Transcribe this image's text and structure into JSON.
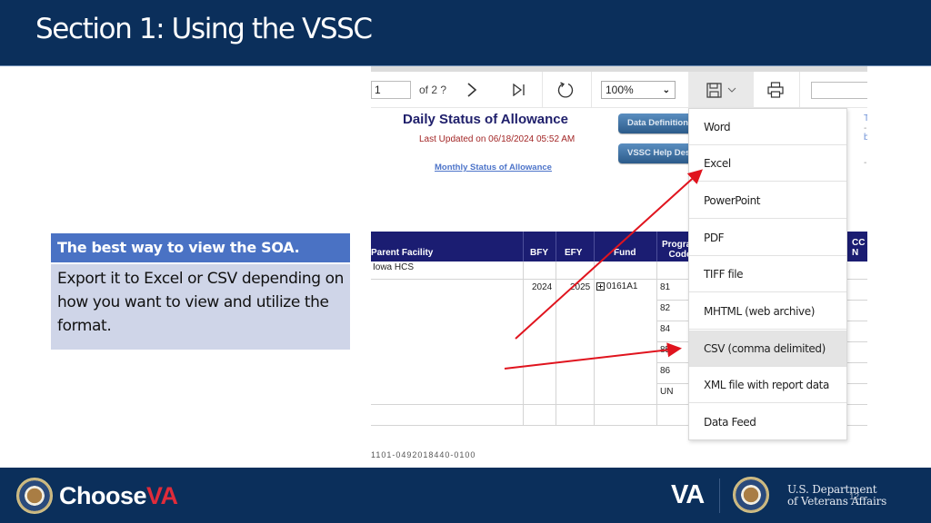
{
  "slide": {
    "title": "Section 1: Using the VSSC",
    "slide_number": "12"
  },
  "callout": {
    "heading": "The best way to view the SOA.",
    "body": "Export it to Excel or CSV depending on how you want to view and utilize the format."
  },
  "toolbar": {
    "page_value": "1",
    "of_pages": "of 2 ?",
    "next_icon": "chevron-right-icon",
    "last_icon": "last-page-icon",
    "refresh_icon": "refresh-icon",
    "zoom_value": "100%",
    "export_icon": "save-icon",
    "print_icon": "print-icon",
    "find_placeholder": ""
  },
  "report": {
    "title": "Daily Status of Allowance",
    "last_updated": "Last Updated on 06/18/2024  05:52 AM",
    "monthly_link": "Monthly Status of Allowance",
    "buttons": [
      "Data Definitions",
      "VSSC Help Desk"
    ],
    "side_text": [
      "T",
      "-",
      "b",
      "-"
    ]
  },
  "table": {
    "headers": [
      "Parent Facility",
      "BFY",
      "EFY",
      "Fund",
      "Program Code",
      "CC N"
    ],
    "facility": "Iowa HCS",
    "bfy": "2024",
    "efy": "2025",
    "fund": "0161A1",
    "fund_icon": "expand-plus-icon",
    "program_codes": [
      "81",
      "82",
      "84",
      "85",
      "86",
      "UN"
    ],
    "footer_fragment": "1101-0492018440-0100"
  },
  "export_menu": {
    "items": [
      {
        "label": "Word"
      },
      {
        "label": "Excel"
      },
      {
        "label": "PowerPoint"
      },
      {
        "label": "PDF"
      },
      {
        "label": "TIFF file"
      },
      {
        "label": "MHTML (web archive)"
      },
      {
        "label": "CSV (comma delimited)",
        "highlighted": true
      },
      {
        "label": "XML file with report data"
      },
      {
        "label": "Data Feed"
      }
    ]
  },
  "annotations": {
    "arrow_color": "#e0141e",
    "arrows": [
      "points-to-excel",
      "points-to-csv"
    ]
  },
  "footer": {
    "choose_va": "Choose",
    "choose_va_mark": "VA",
    "va_logo": "VA",
    "department_line1": "U.S. Department",
    "department_line2": "of Veterans Affairs"
  },
  "colors": {
    "title_bar": "#0b2f5b",
    "callout_head": "#4a72c4",
    "callout_body": "#cfd5e8",
    "table_header": "#1b1d72",
    "report_title": "#1f1f6b",
    "updated_text": "#a32727",
    "menu_hover": "#e4e4e4"
  }
}
